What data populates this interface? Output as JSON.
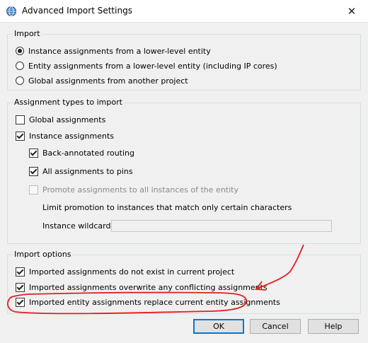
{
  "window": {
    "title": "Advanced Import Settings",
    "close_glyph": "✕"
  },
  "import_group": {
    "title": "Import",
    "options": [
      {
        "label": "Instance assignments from a lower-level entity",
        "selected": true
      },
      {
        "label": "Entity assignments from a lower-level entity (including IP cores)",
        "selected": false
      },
      {
        "label": "Global assignments from another project",
        "selected": false
      }
    ]
  },
  "types_group": {
    "title": "Assignment types to import",
    "global_assignments": {
      "label": "Global assignments",
      "checked": false
    },
    "instance_assignments": {
      "label": "Instance assignments",
      "checked": true
    },
    "back_annotated_routing": {
      "label": "Back-annotated routing",
      "checked": true
    },
    "all_assignments_to_pins": {
      "label": "All assignments to pins",
      "checked": true
    },
    "promote_assignments": {
      "label": "Promote assignments to all instances of the entity",
      "checked": false,
      "disabled": true
    },
    "limit_promotion_text": "Limit promotion to instances that match only certain characters",
    "instance_wildcard": {
      "label": "Instance wildcard:",
      "value": ""
    }
  },
  "options_group": {
    "title": "Import options",
    "not_exist": {
      "label": "Imported assignments do not exist in current project",
      "checked": true
    },
    "overwrite": {
      "label": "Imported assignments overwrite any conflicting assignments",
      "checked": true
    },
    "replace": {
      "label": "Imported entity assignments replace current entity assignments",
      "checked": true
    }
  },
  "buttons": {
    "ok": "OK",
    "cancel": "Cancel",
    "help": "Help"
  },
  "colors": {
    "annotation": "#e41e1e",
    "default_button_border": "#0078d7"
  },
  "icons": {
    "app": "globe-icon",
    "close": "close-icon"
  }
}
